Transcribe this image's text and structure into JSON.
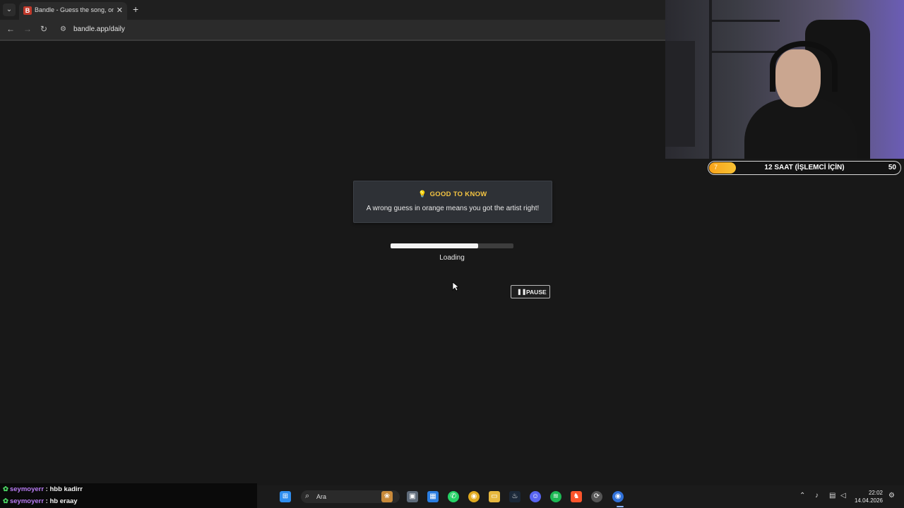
{
  "browser": {
    "tab_title": "Bandle - Guess the song, one in",
    "tab_favicon": "B",
    "url": "bandle.app/daily",
    "icons": {
      "tab_search": "⌄",
      "tab_close": "✕",
      "new_tab": "+",
      "back": "←",
      "forward": "→",
      "reload": "↻",
      "site_info": "⚙"
    }
  },
  "notice": {
    "icon": "💡",
    "heading": "GOOD TO KNOW",
    "text": "A wrong guess in orange means you got the artist right!"
  },
  "player": {
    "progress": 0.71,
    "status": "Loading",
    "pause_icon": "❚❚",
    "pause_label": "PAUSE"
  },
  "stream_widget": {
    "left_value": "7",
    "title": "12 SAAT (İŞLEMCİ İÇİN)",
    "right_value": "50",
    "fill_fraction": 0.14
  },
  "chat": [
    {
      "user": "seymoyerr",
      "message": "hbb kadirr"
    },
    {
      "user": "seymoyerr",
      "message": "hb eraay"
    }
  ],
  "taskbar": {
    "search_placeholder": "Ara",
    "time": "22:02",
    "date": "14.04.2026"
  }
}
